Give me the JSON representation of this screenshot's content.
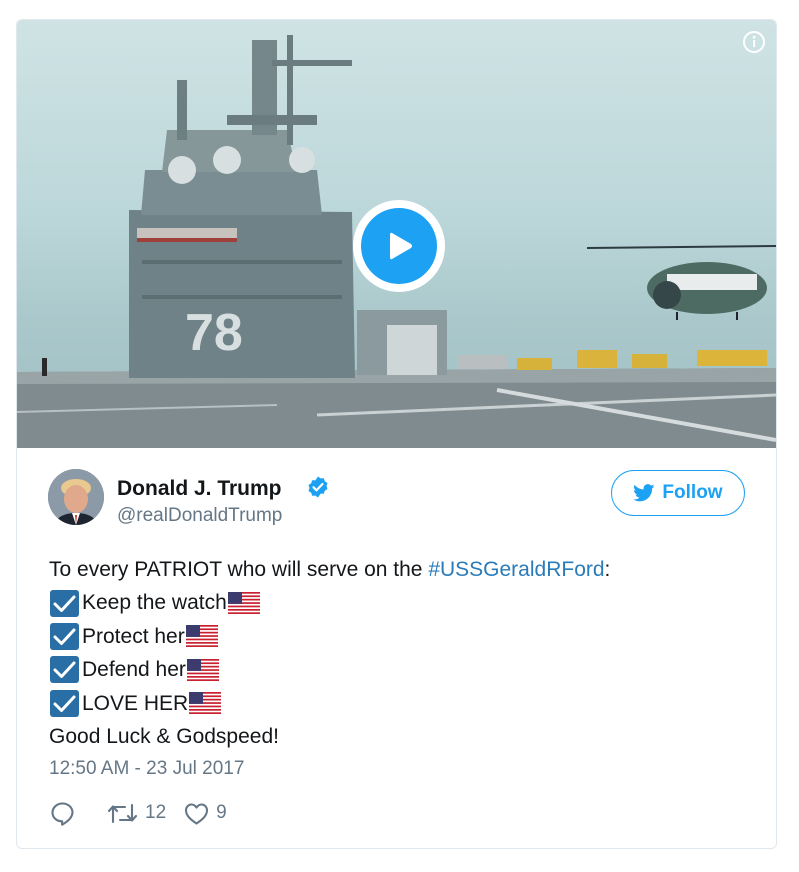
{
  "video": {
    "info_icon": "info-circle-icon",
    "play_icon": "play-icon",
    "hull_number": "78"
  },
  "author": {
    "display_name": "Donald J. Trump",
    "handle": "@realDonaldTrump",
    "verified_icon": "verified-badge-icon",
    "avatar_icon": "profile-avatar"
  },
  "follow": {
    "label": "Follow",
    "icon": "twitter-bird-icon"
  },
  "tweet": {
    "intro_text": "To every PATRIOT who will serve on the ",
    "hashtag": "#USSGeraldRFord",
    "intro_suffix": ":",
    "checklist": [
      "Keep the watch",
      "Protect her",
      "Defend her",
      "LOVE HER"
    ],
    "checklist_icon": "check-box-icon",
    "flag_icon": "us-flag-icon",
    "closing": "Good Luck & Godspeed!"
  },
  "timestamp": "12:50 AM - 23 Jul 2017",
  "actions": {
    "reply_icon": "reply-icon",
    "retweet_icon": "retweet-icon",
    "retweet_count": "12",
    "like_icon": "heart-icon",
    "like_count": "9"
  },
  "colors": {
    "accent": "#1da1f2",
    "hashtag": "#2b7bb9",
    "secondary_text": "#657786",
    "border": "#e1e8ed"
  }
}
